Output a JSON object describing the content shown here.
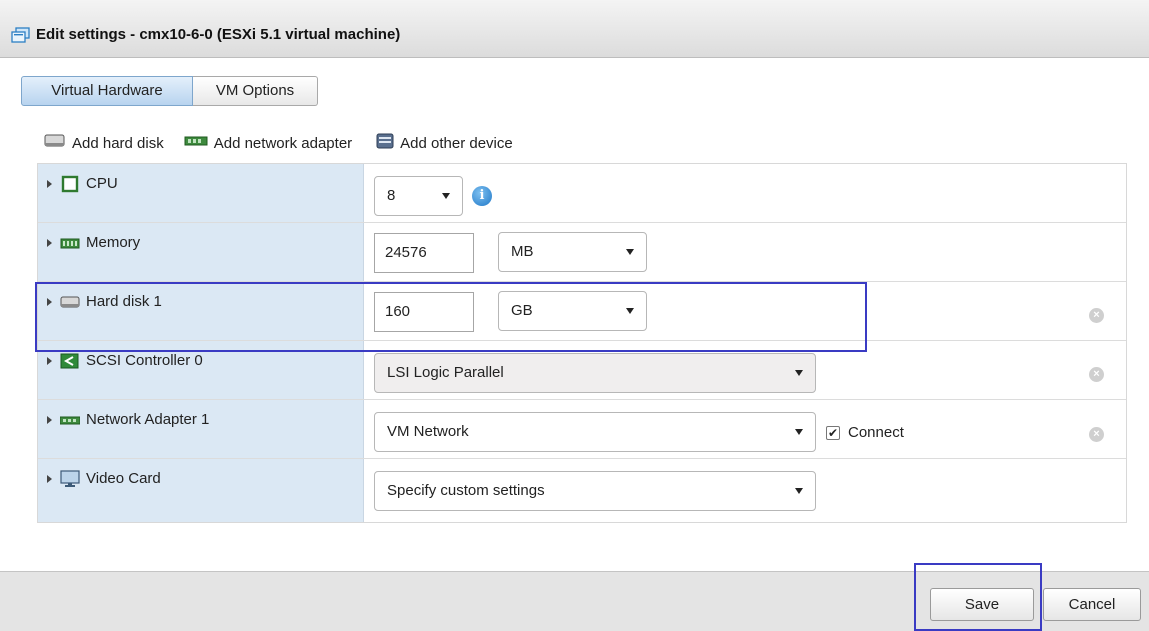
{
  "window": {
    "title": "Edit settings - cmx10-6-0 (ESXi 5.1 virtual machine)"
  },
  "tabs": [
    {
      "label": "Virtual Hardware",
      "active": true
    },
    {
      "label": "VM Options",
      "active": false
    }
  ],
  "toolbar": {
    "add_hard_disk": "Add hard disk",
    "add_network_adapter": "Add network adapter",
    "add_other_device": "Add other device"
  },
  "devices": {
    "cpu": {
      "label": "CPU",
      "value": "8",
      "icon": "cpu-icon"
    },
    "memory": {
      "label": "Memory",
      "value": "24576",
      "unit": "MB",
      "icon": "memory-icon"
    },
    "hard_disk": {
      "label": "Hard disk 1",
      "value": "160",
      "unit": "GB",
      "icon": "hard-disk-icon"
    },
    "scsi": {
      "label": "SCSI Controller 0",
      "value": "LSI Logic Parallel",
      "icon": "scsi-controller-icon"
    },
    "network": {
      "label": "Network Adapter 1",
      "value": "VM Network",
      "connect_label": "Connect",
      "connected": true,
      "icon": "network-adapter-icon"
    },
    "video": {
      "label": "Video Card",
      "value": "Specify custom settings",
      "icon": "video-card-icon"
    }
  },
  "footer": {
    "save_label": "Save",
    "cancel_label": "Cancel"
  },
  "colors": {
    "highlight": "#3a3bc3",
    "left_column": "#dbe8f4",
    "active_tab": "#b8d4ef"
  }
}
